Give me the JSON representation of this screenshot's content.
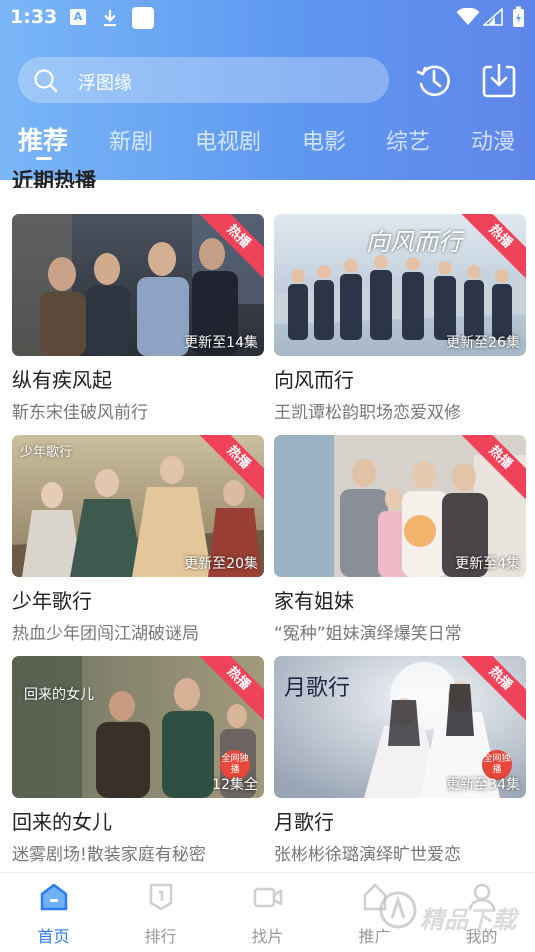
{
  "status_bar": {
    "time": "1:33",
    "notif_a": "A"
  },
  "search": {
    "placeholder_text": "浮图缘"
  },
  "tabs": [
    {
      "label": "推荐",
      "active": true
    },
    {
      "label": "新剧"
    },
    {
      "label": "电视剧"
    },
    {
      "label": "电影"
    },
    {
      "label": "综艺"
    },
    {
      "label": "动漫"
    }
  ],
  "section": {
    "title": "近期热播"
  },
  "cards": [
    {
      "title": "纵有疾风起",
      "desc": "靳东宋佳破风前行",
      "badge": "热播",
      "episode": "更新至14集"
    },
    {
      "title": "向风而行",
      "desc": "王凯谭松韵职场恋爱双修",
      "badge": "热播",
      "episode": "更新至26集",
      "poster_text": "向风而行"
    },
    {
      "title": "少年歌行",
      "desc": "热血少年团闯江湖破谜局",
      "badge": "热播",
      "episode": "更新至20集",
      "poster_text": "少年歌行"
    },
    {
      "title": "家有姐妹",
      "desc": "“冤种”姐妹演绎爆笑日常",
      "badge": "热播",
      "episode": "更新至4集"
    },
    {
      "title": "回来的女儿",
      "desc": "迷雾剧场!散装家庭有秘密",
      "badge": "热播",
      "episode": "12集全",
      "poster_text": "回来的女儿",
      "corner_badge": "全网独播"
    },
    {
      "title": "月歌行",
      "desc": "张彬彬徐璐演绎旷世爱恋",
      "badge": "热播",
      "episode": "更新至34集",
      "poster_text": "月歌行",
      "corner_badge": "全网独播"
    }
  ],
  "bottom_nav": [
    {
      "label": "首页",
      "icon": "home-icon",
      "active": true
    },
    {
      "label": "排行",
      "icon": "rank-icon"
    },
    {
      "label": "找片",
      "icon": "video-icon"
    },
    {
      "label": "推广",
      "icon": "share-icon"
    },
    {
      "label": "我的",
      "icon": "user-icon"
    }
  ],
  "watermark": "精品下载",
  "colors": {
    "accent": "#2f7cf1",
    "header_start": "#7ab6f7",
    "header_end": "#5f86ea",
    "hot_badge": "#f0435a"
  }
}
